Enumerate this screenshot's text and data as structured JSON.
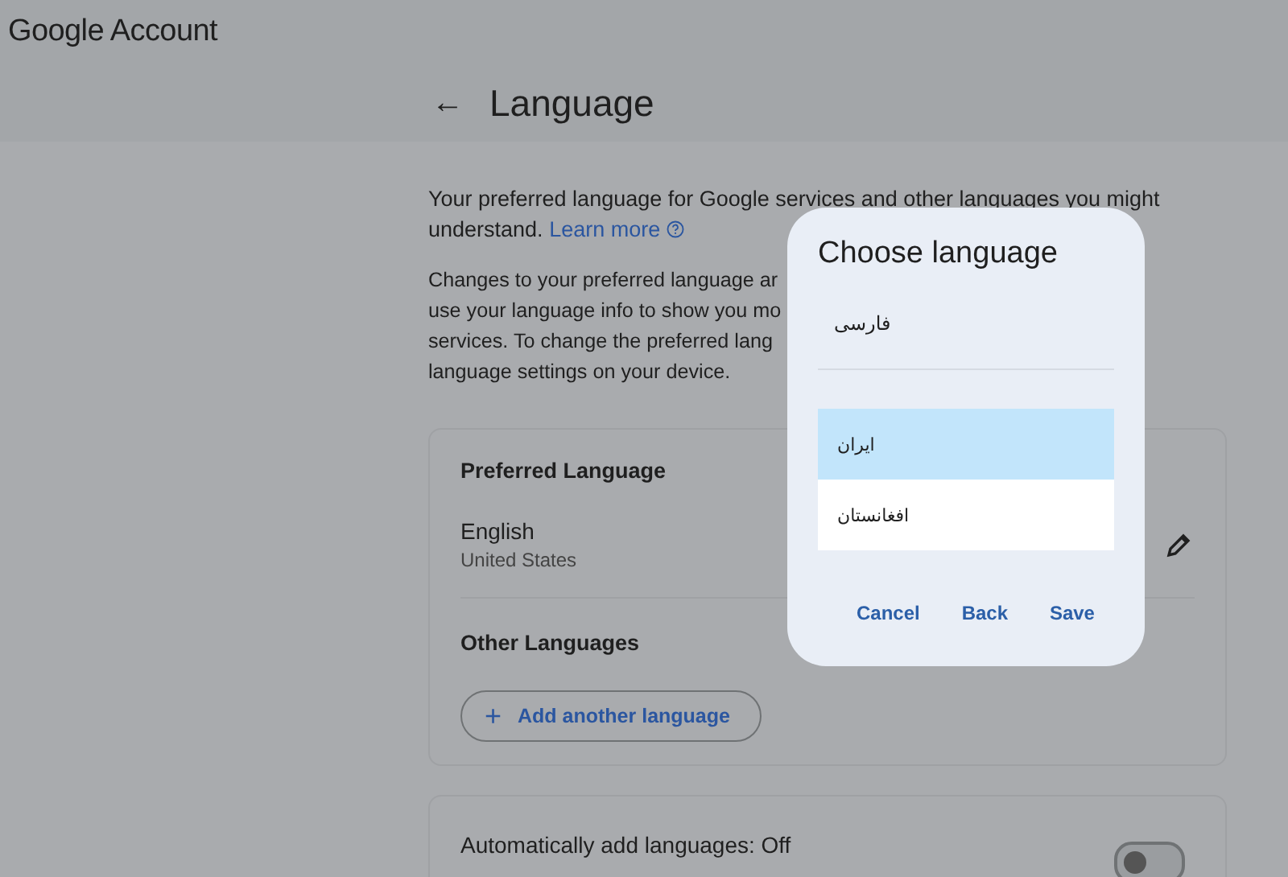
{
  "header": {
    "brand": "Google Account",
    "back_label": "←",
    "title": "Language"
  },
  "intro": {
    "text": "Your preferred language for Google services and other languages you might understand.",
    "link": "Learn more"
  },
  "notice_lines": [
    "Changes to your preferred language ar",
    "use your language info to show you mo",
    "services. To change the preferred lang",
    "language settings on your device."
  ],
  "preferred_card": {
    "heading": "Preferred Language",
    "language": "English",
    "region": "United States",
    "other_heading": "Other Languages",
    "add_button": {
      "icon": "+",
      "label": "Add another language"
    }
  },
  "auto_card": {
    "label": "Automatically add languages: Off",
    "toggle": {
      "on": false
    }
  },
  "dialog": {
    "title": "Choose language",
    "field_value": "فارسی",
    "options": [
      {
        "label": "ایران",
        "selected": true
      },
      {
        "label": "افغانستان",
        "selected": false
      }
    ],
    "buttons": [
      "Cancel",
      "Back",
      "Save"
    ]
  }
}
